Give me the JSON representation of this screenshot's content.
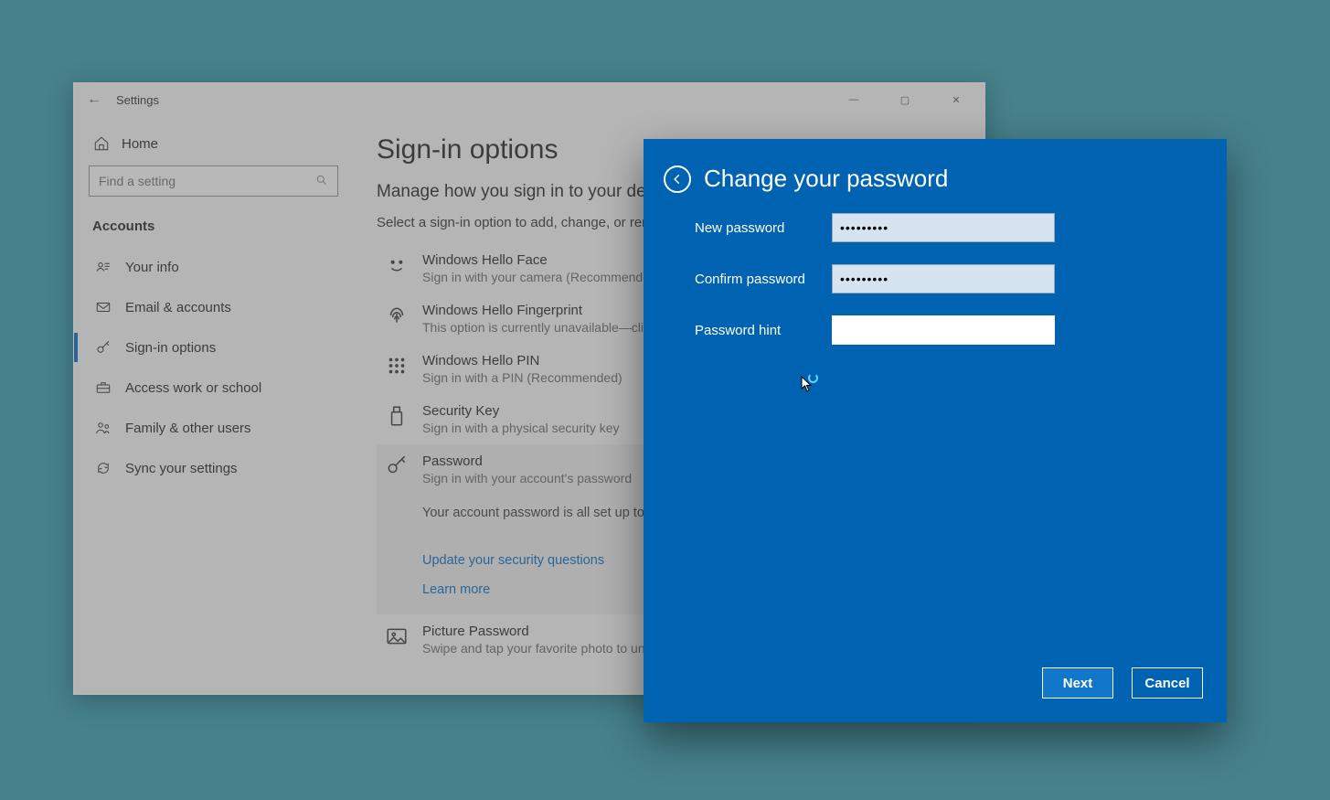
{
  "window": {
    "title": "Settings",
    "controls": {
      "min": "—",
      "max": "▢",
      "close": "✕"
    }
  },
  "sidebar": {
    "home": "Home",
    "search_placeholder": "Find a setting",
    "section": "Accounts",
    "items": [
      {
        "label": "Your info"
      },
      {
        "label": "Email & accounts"
      },
      {
        "label": "Sign-in options"
      },
      {
        "label": "Access work or school"
      },
      {
        "label": "Family & other users"
      },
      {
        "label": "Sync your settings"
      }
    ],
    "active_index": 2
  },
  "content": {
    "heading": "Sign-in options",
    "subheading": "Manage how you sign in to your device",
    "hint": "Select a sign-in option to add, change, or remove it.",
    "options": [
      {
        "title": "Windows Hello Face",
        "desc": "Sign in with your camera (Recommended)"
      },
      {
        "title": "Windows Hello Fingerprint",
        "desc": "This option is currently unavailable—click to learn more"
      },
      {
        "title": "Windows Hello PIN",
        "desc": "Sign in with a PIN (Recommended)"
      },
      {
        "title": "Security Key",
        "desc": "Sign in with a physical security key"
      },
      {
        "title": "Password",
        "desc": "Sign in with your account's password",
        "extra": "Your account password is all set up to sign in to Windows, apps, and services.",
        "link1": "Update your security questions",
        "link2": "Learn more"
      },
      {
        "title": "Picture Password",
        "desc": "Swipe and tap your favorite photo to unlock your device"
      }
    ]
  },
  "modal": {
    "title": "Change your password",
    "labels": {
      "new": "New password",
      "confirm": "Confirm password",
      "hint": "Password hint"
    },
    "values": {
      "new": "•••••••••",
      "confirm": "•••••••••",
      "hint": ""
    },
    "buttons": {
      "next": "Next",
      "cancel": "Cancel"
    }
  }
}
